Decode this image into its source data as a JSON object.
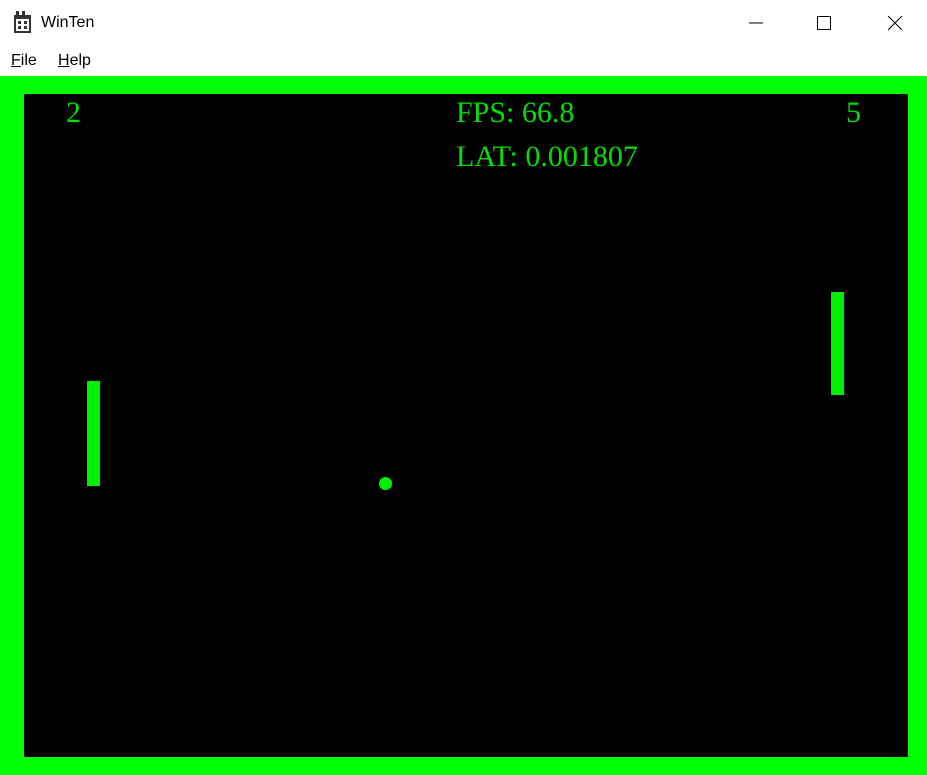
{
  "window": {
    "title": "WinTen"
  },
  "menu": {
    "file": {
      "mnemonic": "F",
      "rest": "ile"
    },
    "help": {
      "mnemonic": "H",
      "rest": "elp"
    }
  },
  "game": {
    "score_left": "2",
    "score_right": "5",
    "fps": "FPS: 66.8",
    "latency": "LAT: 0.001807"
  },
  "colors": {
    "border": "#00ff00",
    "court": "#000000",
    "foreground": "#00e000"
  }
}
